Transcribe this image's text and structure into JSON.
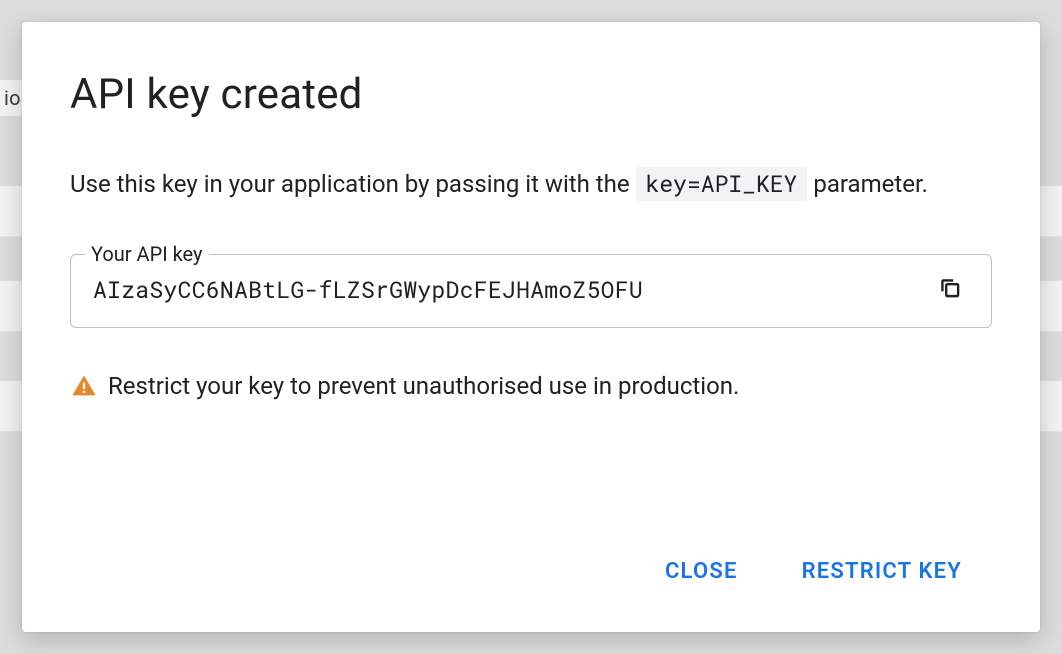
{
  "background": {
    "tab_fragment": "io"
  },
  "dialog": {
    "title": "API key created",
    "instruction_prefix": "Use this key in your application by passing it with the ",
    "instruction_code": "key=API_KEY",
    "instruction_suffix": " parameter.",
    "field_label": "Your API key",
    "api_key": "AIzaSyCC6NABtLG-fLZSrGWypDcFEJHAmoZ5OFU",
    "warning_text": "Restrict your key to prevent unauthorised use in production.",
    "actions": {
      "close": "CLOSE",
      "restrict": "RESTRICT KEY"
    }
  }
}
